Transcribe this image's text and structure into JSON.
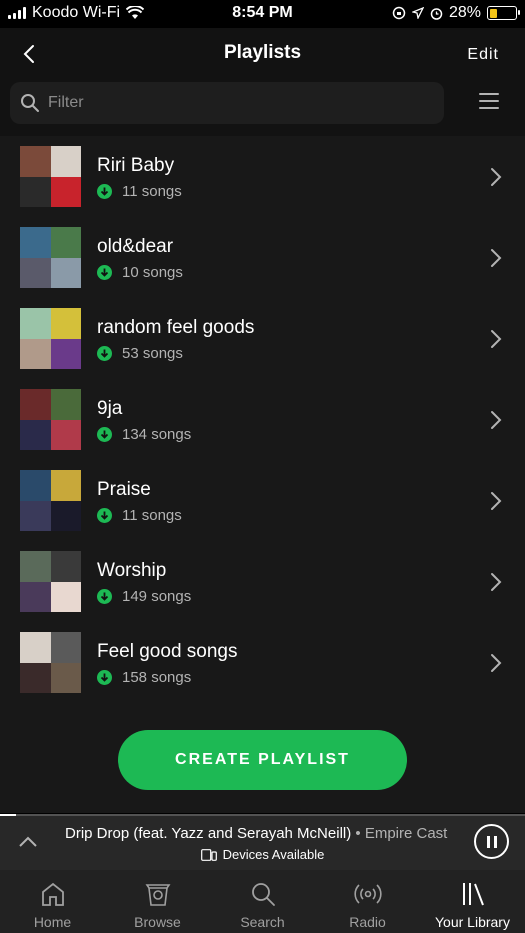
{
  "status_bar": {
    "carrier": "Koodo Wi-Fi",
    "time": "8:54 PM",
    "battery": "28%",
    "battery_level": 0.28
  },
  "header": {
    "title": "Playlists",
    "edit_label": "Edit"
  },
  "filter": {
    "placeholder": "Filter"
  },
  "playlists": [
    {
      "name": "Riri Baby",
      "count": "11 songs",
      "colors": [
        "#7b4a3a",
        "#d8d0c8",
        "#2a2a2a",
        "#c8232c"
      ]
    },
    {
      "name": "old&dear",
      "count": "10 songs",
      "colors": [
        "#3b6a8c",
        "#4a7a4a",
        "#5a5a6a",
        "#8a9aa8"
      ]
    },
    {
      "name": "random feel goods",
      "count": "53 songs",
      "colors": [
        "#9ac4a8",
        "#d4c03a",
        "#b09a8a",
        "#6a3a8a"
      ]
    },
    {
      "name": "9ja",
      "count": "134 songs",
      "colors": [
        "#6a2a2a",
        "#4a6a3a",
        "#2a2a4a",
        "#b03a4a"
      ]
    },
    {
      "name": "Praise",
      "count": "11 songs",
      "colors": [
        "#2a4a6a",
        "#c8a83a",
        "#3a3a5a",
        "#1a1a2a"
      ]
    },
    {
      "name": "Worship",
      "count": "149 songs",
      "colors": [
        "#5a6a5a",
        "#3a3a3a",
        "#4a3a5a",
        "#e8d8d0"
      ]
    },
    {
      "name": "Feel good songs",
      "count": "158 songs",
      "colors": [
        "#d8d0c8",
        "#5a5a5a",
        "#3a2a2a",
        "#6a5a4a"
      ]
    }
  ],
  "create_button": "CREATE PLAYLIST",
  "now_playing": {
    "track": "Drip Drop (feat. Yazz and Serayah McNeill)",
    "separator": " • ",
    "artist": "Empire Cast",
    "devices": "Devices Available",
    "progress": 0.03
  },
  "tabs": [
    {
      "label": "Home",
      "icon": "home-icon",
      "active": false
    },
    {
      "label": "Browse",
      "icon": "browse-icon",
      "active": false
    },
    {
      "label": "Search",
      "icon": "search-icon",
      "active": false
    },
    {
      "label": "Radio",
      "icon": "radio-icon",
      "active": false
    },
    {
      "label": "Your Library",
      "icon": "library-icon",
      "active": true
    }
  ],
  "colors": {
    "accent": "#1db954",
    "background": "#121212",
    "list_background": "#181818"
  }
}
